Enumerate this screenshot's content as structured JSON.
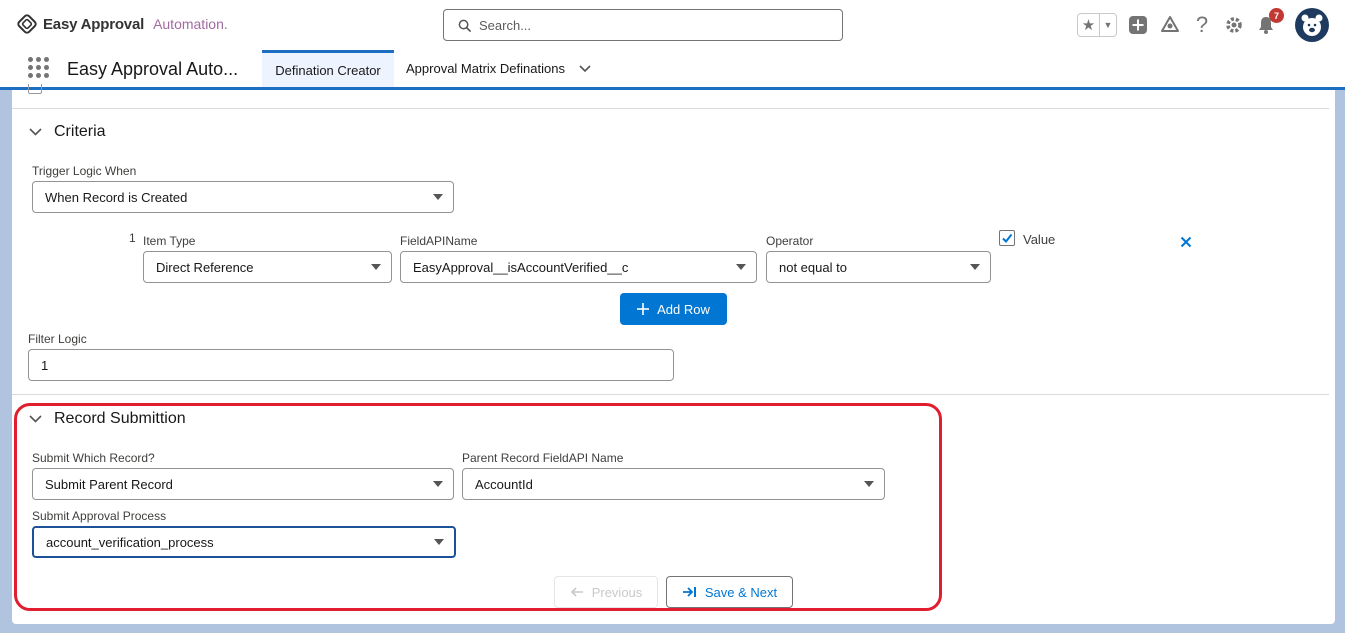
{
  "header": {
    "logo_bold": "Easy Approval",
    "logo_light": "Automation.",
    "search_placeholder": "Search...",
    "notification_count": "7"
  },
  "nav": {
    "app_name": "Easy Approval Auto...",
    "tabs": [
      {
        "label": "Defination Creator",
        "active": true
      },
      {
        "label": "Approval Matrix Definations",
        "active": false
      }
    ]
  },
  "criteria": {
    "title": "Criteria",
    "trigger_label": "Trigger Logic When",
    "trigger_value": "When Record is Created",
    "rows": [
      {
        "number": "1",
        "item_type_label": "Item Type",
        "item_type_value": "Direct Reference",
        "field_label": "FieldAPIName",
        "field_value": "EasyApproval__isAccountVerified__c",
        "operator_label": "Operator",
        "operator_value": "not equal to",
        "value_label": "Value",
        "value_checked": true
      }
    ],
    "add_row_label": "Add Row",
    "filter_logic_label": "Filter Logic",
    "filter_logic_value": "1"
  },
  "submission": {
    "title": "Record Submittion",
    "which_label": "Submit Which Record?",
    "which_value": "Submit Parent Record",
    "parent_field_label": "Parent Record FieldAPI Name",
    "parent_field_value": "AccountId",
    "process_label": "Submit Approval Process",
    "process_value": "account_verification_process",
    "previous_label": "Previous",
    "save_next_label": "Save & Next"
  },
  "colors": {
    "brand": "#0176d3",
    "highlight": "#e01e2f",
    "badge": "#c23934"
  }
}
